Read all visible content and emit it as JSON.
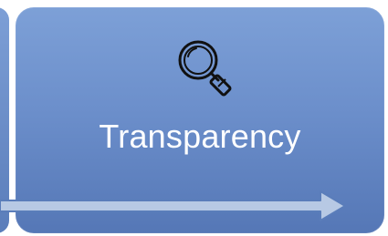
{
  "card": {
    "label": "Transparency",
    "icon": "magnifying-glass-icon"
  },
  "colors": {
    "card_top": "#7da0d7",
    "card_bottom": "#5577b6",
    "arrow_fill": "#b7c9e4",
    "arrow_stroke": "#5a7dba"
  }
}
